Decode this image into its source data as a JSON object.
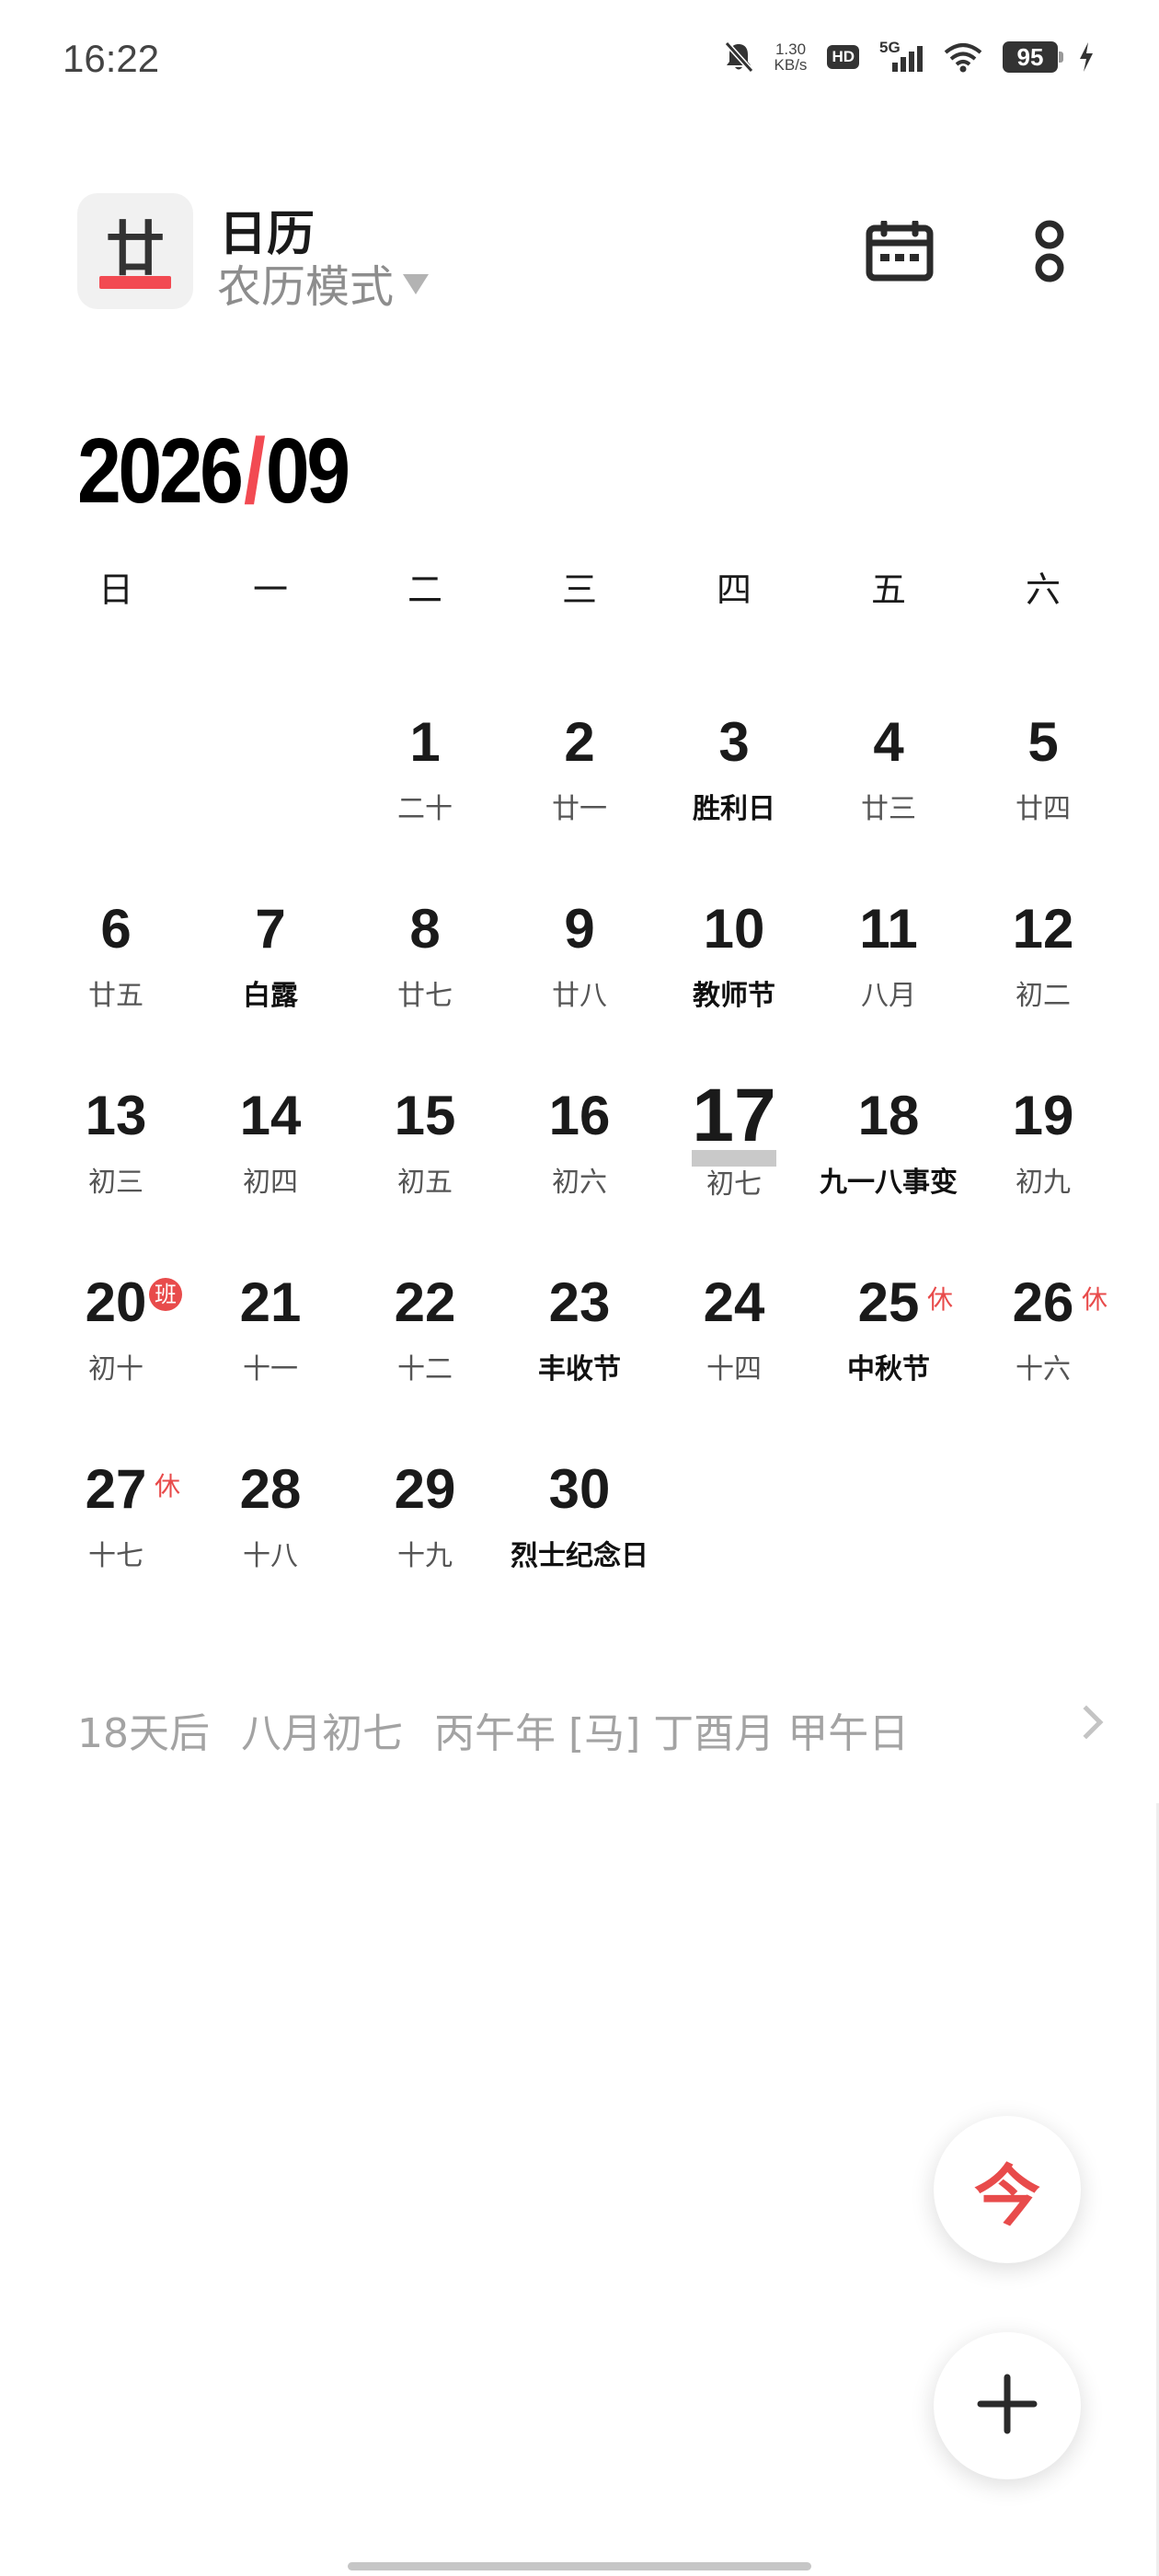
{
  "status_bar": {
    "time": "16:22",
    "net_speed_value": "1.30",
    "net_speed_unit": "KB/s",
    "hd_label": "HD",
    "network_label": "5G",
    "battery": "95",
    "icons": [
      "bell-muted-icon",
      "hd-icon",
      "signal-5g-icon",
      "wifi-icon",
      "battery-icon",
      "charging-icon"
    ]
  },
  "header": {
    "logo_glyph": "廿",
    "title": "日历",
    "mode_label": "农历模式",
    "icons": [
      "calendar-view-icon",
      "more-icon"
    ],
    "accent_color": "#f24a52"
  },
  "month": {
    "year": "2026",
    "separator": "/",
    "month": "09"
  },
  "weekdays": [
    "日",
    "一",
    "二",
    "三",
    "四",
    "五",
    "六"
  ],
  "days": [
    {
      "num": "1",
      "sub": "二十"
    },
    {
      "num": "2",
      "sub": "廿一"
    },
    {
      "num": "3",
      "sub": "胜利日"
    },
    {
      "num": "4",
      "sub": "廿三"
    },
    {
      "num": "5",
      "sub": "廿四"
    },
    {
      "num": "6",
      "sub": "廿五"
    },
    {
      "num": "7",
      "sub": "白露"
    },
    {
      "num": "8",
      "sub": "廿七"
    },
    {
      "num": "9",
      "sub": "廿八"
    },
    {
      "num": "10",
      "sub": "教师节"
    },
    {
      "num": "11",
      "sub": "八月"
    },
    {
      "num": "12",
      "sub": "初二"
    },
    {
      "num": "13",
      "sub": "初三"
    },
    {
      "num": "14",
      "sub": "初四"
    },
    {
      "num": "15",
      "sub": "初五"
    },
    {
      "num": "16",
      "sub": "初六"
    },
    {
      "num": "17",
      "sub": "初七"
    },
    {
      "num": "18",
      "sub": "九一八事变"
    },
    {
      "num": "19",
      "sub": "初九"
    },
    {
      "num": "20",
      "sub": "初十",
      "tag": "班"
    },
    {
      "num": "21",
      "sub": "十一"
    },
    {
      "num": "22",
      "sub": "十二"
    },
    {
      "num": "23",
      "sub": "丰收节"
    },
    {
      "num": "24",
      "sub": "十四"
    },
    {
      "num": "25",
      "sub": "中秋节",
      "tag": "休"
    },
    {
      "num": "26",
      "sub": "十六",
      "tag": "休"
    },
    {
      "num": "27",
      "sub": "十七",
      "tag": "休"
    },
    {
      "num": "28",
      "sub": "十八"
    },
    {
      "num": "29",
      "sub": "十九"
    },
    {
      "num": "30",
      "sub": "烈士纪念日"
    }
  ],
  "info": {
    "days_after": "18天后",
    "lunar_date": "八月初七",
    "ganzhi": "丙午年 [马] 丁酉月 甲午日"
  },
  "fab_today_label": "今",
  "fab_add_icon": "plus-icon"
}
